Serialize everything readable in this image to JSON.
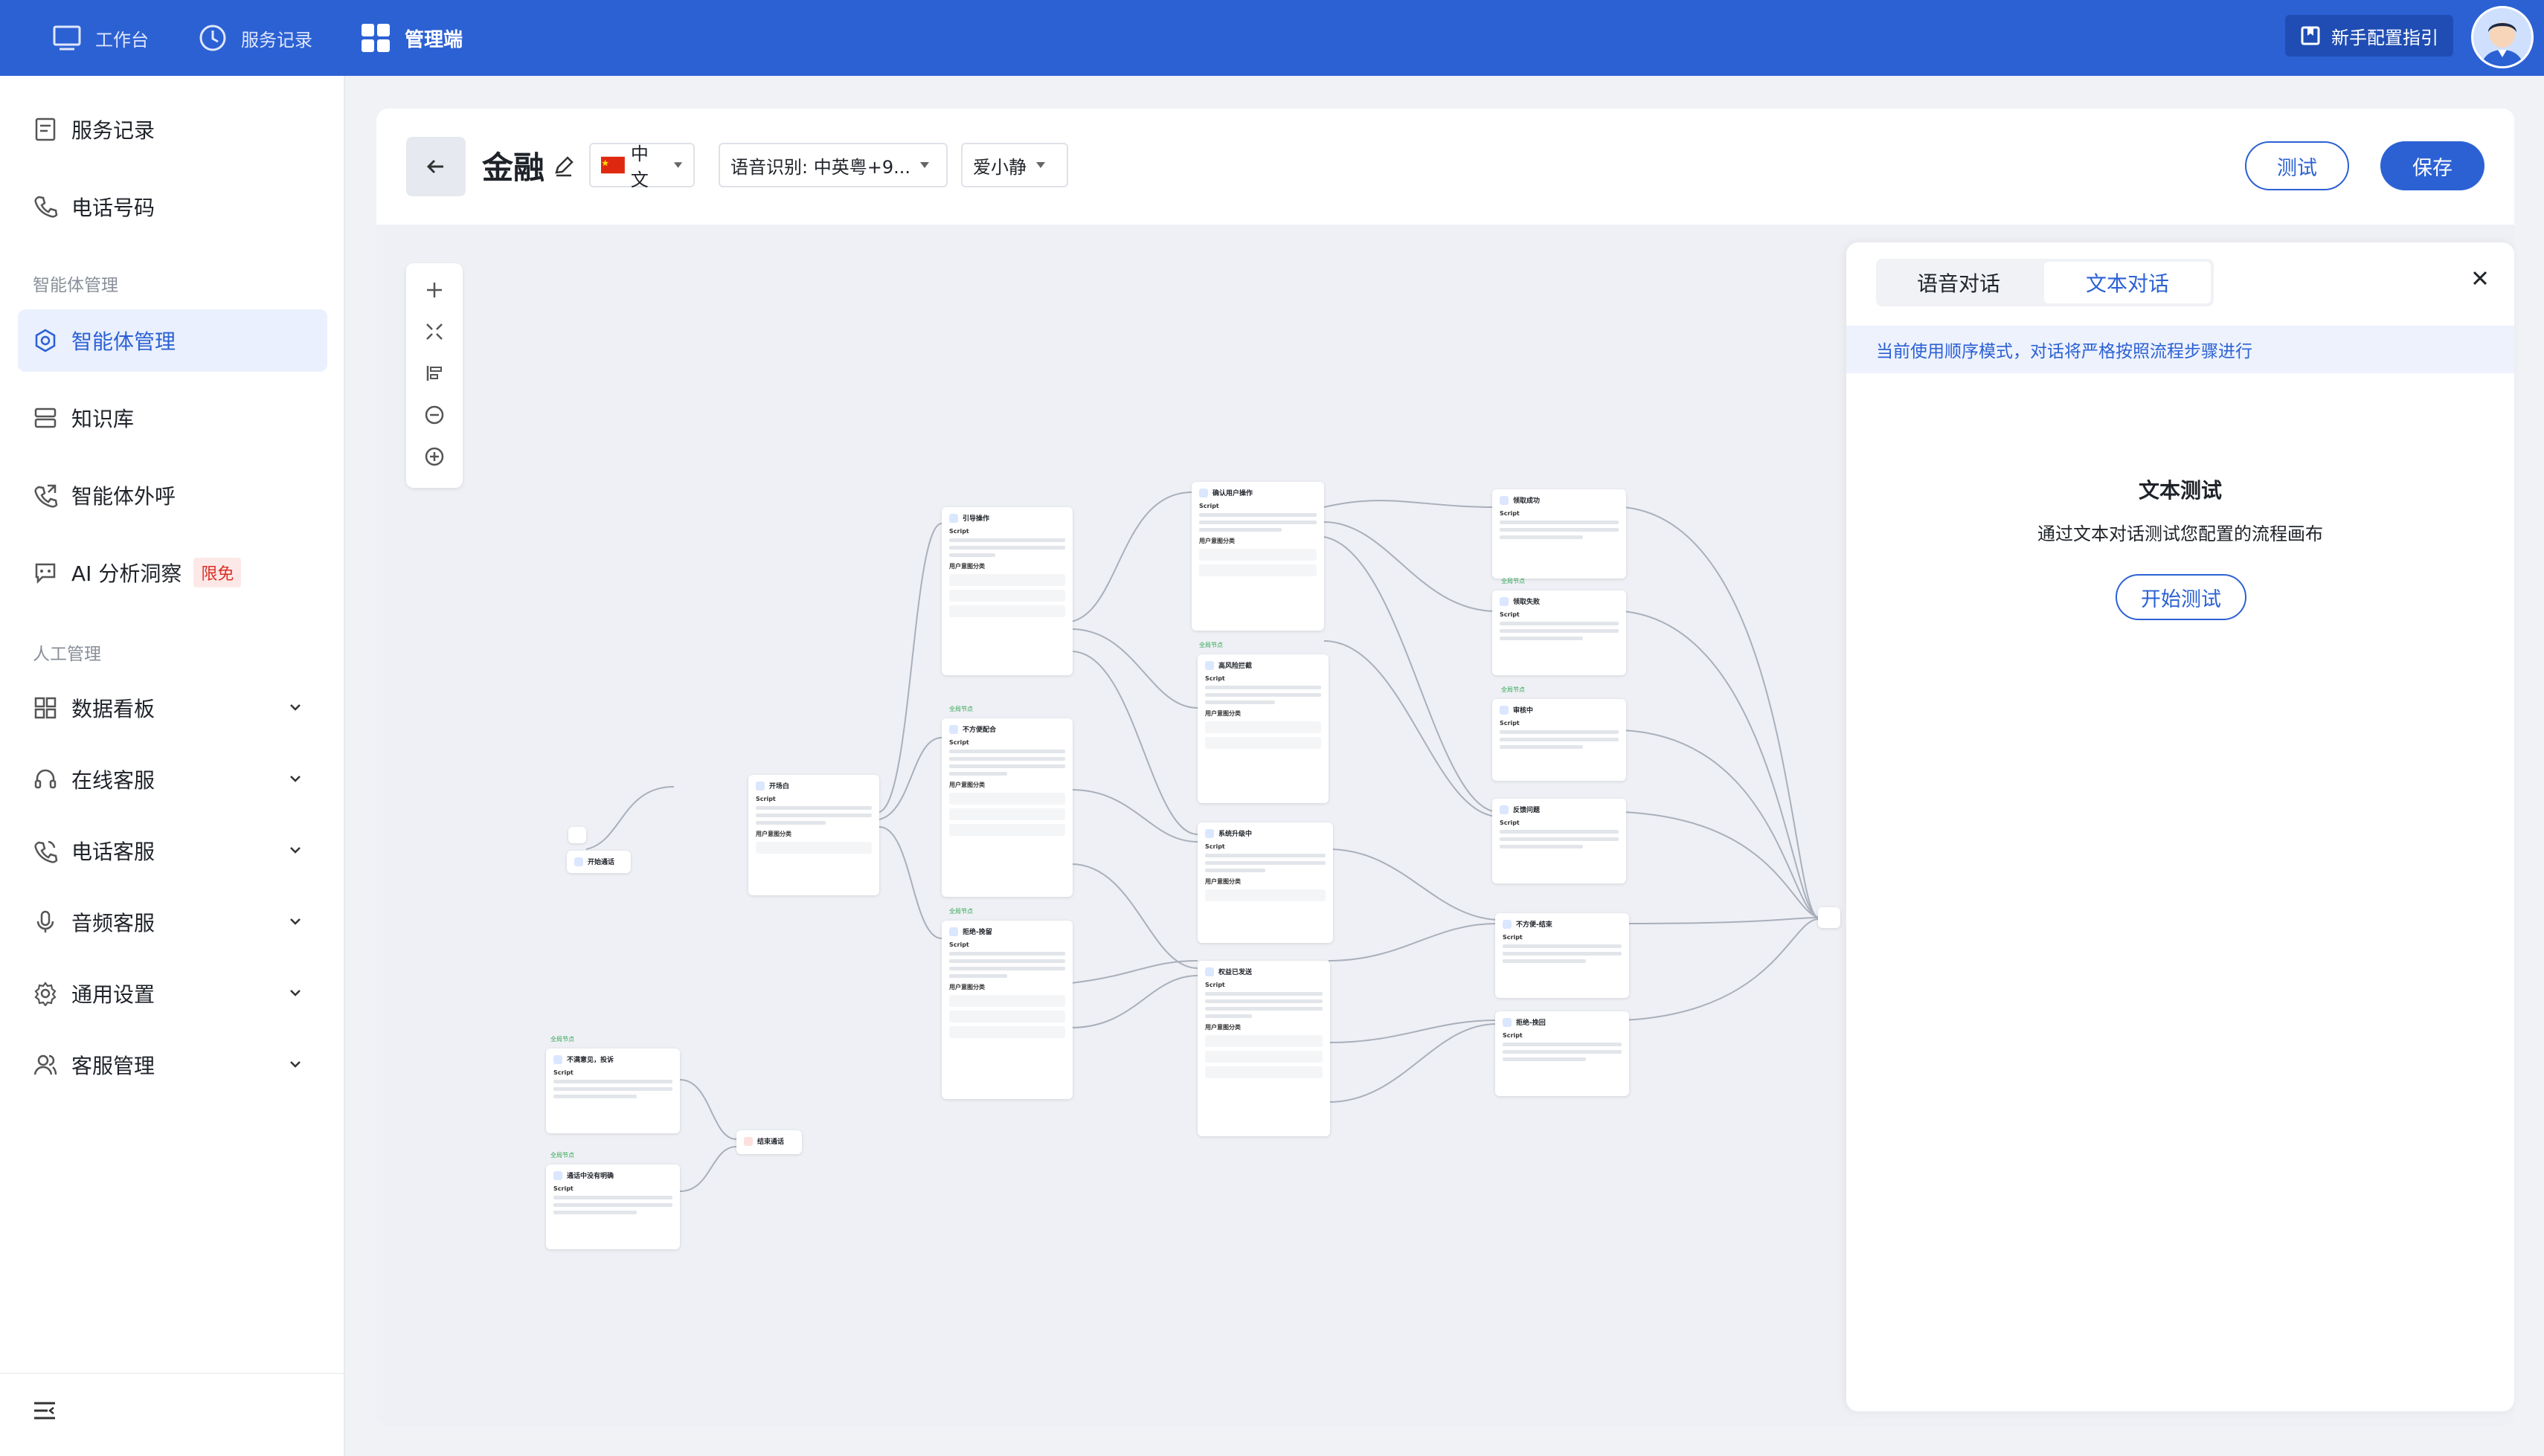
{
  "topbar": {
    "nav": [
      {
        "label": "工作台",
        "icon": "monitor-icon"
      },
      {
        "label": "服务记录",
        "icon": "clock-icon"
      },
      {
        "label": "管理端",
        "icon": "grid-icon"
      }
    ],
    "guide_label": "新手配置指引",
    "colors": {
      "bar": "#2c61d4",
      "accent": "#2c61d4"
    }
  },
  "sidebar": {
    "top_items": [
      {
        "label": "服务记录",
        "icon": "document-icon"
      },
      {
        "label": "电话号码",
        "icon": "phone-icon"
      }
    ],
    "section_agents": "智能体管理",
    "agent_items": [
      {
        "label": "智能体管理",
        "icon": "hexagon-icon",
        "active": true
      },
      {
        "label": "知识库",
        "icon": "database-icon"
      },
      {
        "label": "智能体外呼",
        "icon": "phone-outgoing-icon"
      },
      {
        "label": "AI 分析洞察",
        "icon": "ai-chat-icon",
        "badge": "限免"
      }
    ],
    "section_human": "人工管理",
    "human_items": [
      {
        "label": "数据看板",
        "icon": "dashboard-icon"
      },
      {
        "label": "在线客服",
        "icon": "headset-icon"
      },
      {
        "label": "电话客服",
        "icon": "phone-call-icon"
      },
      {
        "label": "音频客服",
        "icon": "microphone-icon"
      },
      {
        "label": "通用设置",
        "icon": "gear-icon"
      },
      {
        "label": "客服管理",
        "icon": "users-icon"
      }
    ]
  },
  "editor": {
    "title": "金融",
    "language": "中文",
    "asr": "语音识别: 中英粤+9...",
    "voice": "爱小静",
    "test_label": "测试",
    "save_label": "保存"
  },
  "flow": {
    "nodes": {
      "start": "开始通话",
      "open": "开场白",
      "guide": "引导操作",
      "no_will": "不方便配合",
      "refuse": "拒绝-挽留",
      "confirm": "确认用户操作",
      "high_risk": "高风险拦截",
      "upgrade": "系统升级中",
      "sent": "权益已发送",
      "success": "领取成功",
      "fail": "领取失败",
      "wait": "审核中",
      "issue": "反馈问题",
      "unwilling": "不方便-结束",
      "reject_end": "拒绝-挽回",
      "complain": "不满意见，投诉",
      "spam": "通话中没有明确",
      "end": "结束通话"
    },
    "script_label": "Script",
    "intent_label": "用户意图分类",
    "global_tag": "全局节点"
  },
  "chat_panel": {
    "tabs": [
      "语音对话",
      "文本对话"
    ],
    "active_tab": 1,
    "notice": "当前使用顺序模式，对话将严格按照流程步骤进行",
    "test_title": "文本测试",
    "test_desc": "通过文本对话测试您配置的流程画布",
    "start_label": "开始测试"
  }
}
